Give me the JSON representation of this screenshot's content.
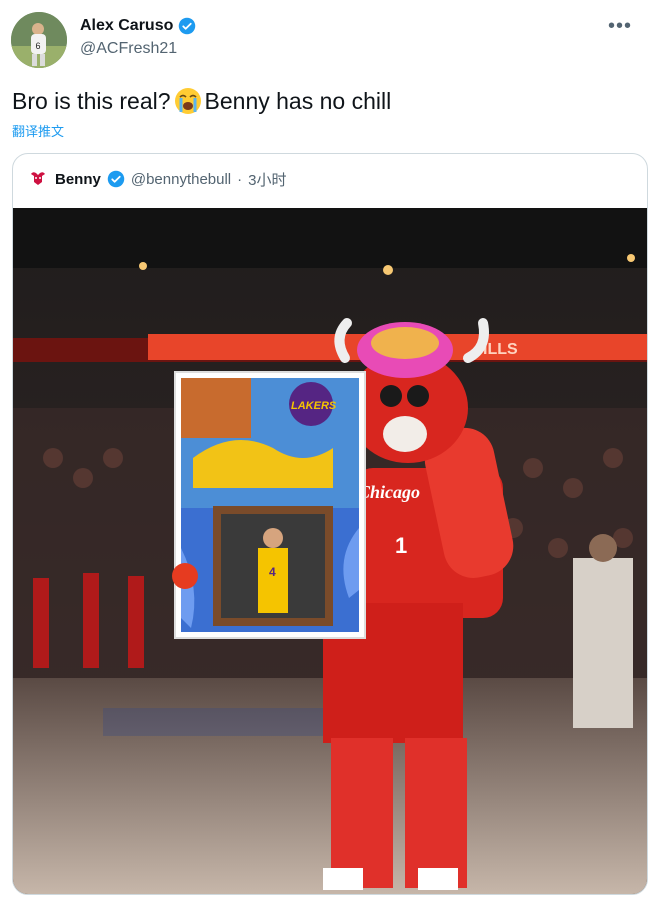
{
  "author": {
    "display_name": "Alex Caruso",
    "handle": "@ACFresh21",
    "verified_icon": "verified-badge-icon",
    "avatar_icon": "profile-photo"
  },
  "menu": {
    "more_label": "•••"
  },
  "tweet": {
    "text_before": "Bro is this real?",
    "emoji": "loudly-crying-face",
    "text_after": "Benny has no chill",
    "translate_label": "翻译推文"
  },
  "quoted": {
    "display_name": "Benny",
    "handle": "@bennythebull",
    "separator": "·",
    "time": "3小时",
    "media_description_icon": "benny-mascot-photo",
    "poster_logo_text": "LAKERS",
    "jersey_text": "Chicago",
    "jersey_number": "1",
    "framed_jersey_number": "4"
  },
  "colors": {
    "accent": "#1d9bf0",
    "text": "#0f1419",
    "muted": "#536471",
    "bulls_red": "#c8102e"
  }
}
